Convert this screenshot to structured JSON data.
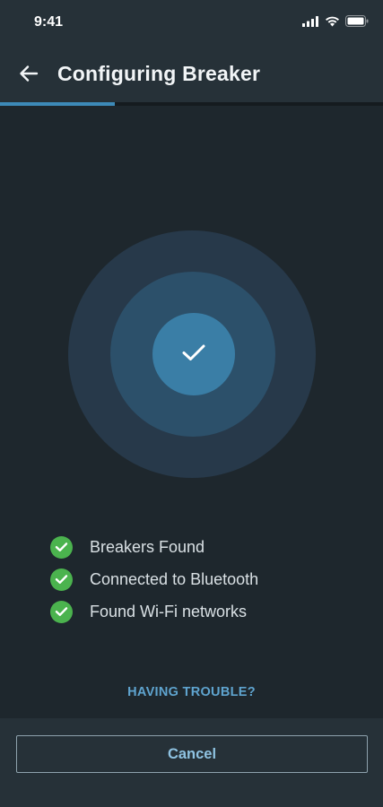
{
  "status_bar": {
    "time": "9:41",
    "icons": [
      "signal-icon",
      "wifi-icon",
      "battery-icon"
    ]
  },
  "header": {
    "title": "Configuring Breaker",
    "back_icon": "arrow-left-icon"
  },
  "progress": {
    "fraction": 0.3,
    "color": "#3d8ab8"
  },
  "status_graphic": {
    "icon": "checkmark-icon",
    "colors": [
      "#27394a",
      "#2c506a",
      "#3a7ea6"
    ]
  },
  "checklist": [
    {
      "label": "Breakers Found",
      "icon": "check-circle-icon"
    },
    {
      "label": "Connected to Bluetooth",
      "icon": "check-circle-icon"
    },
    {
      "label": "Found Wi-Fi networks",
      "icon": "check-circle-icon"
    }
  ],
  "help_link": "HAVING TROUBLE?",
  "footer": {
    "cancel_label": "Cancel"
  },
  "colors": {
    "background": "#1e272d",
    "bar": "#263138",
    "success": "#4bb34e",
    "accent": "#5fa4cf"
  }
}
